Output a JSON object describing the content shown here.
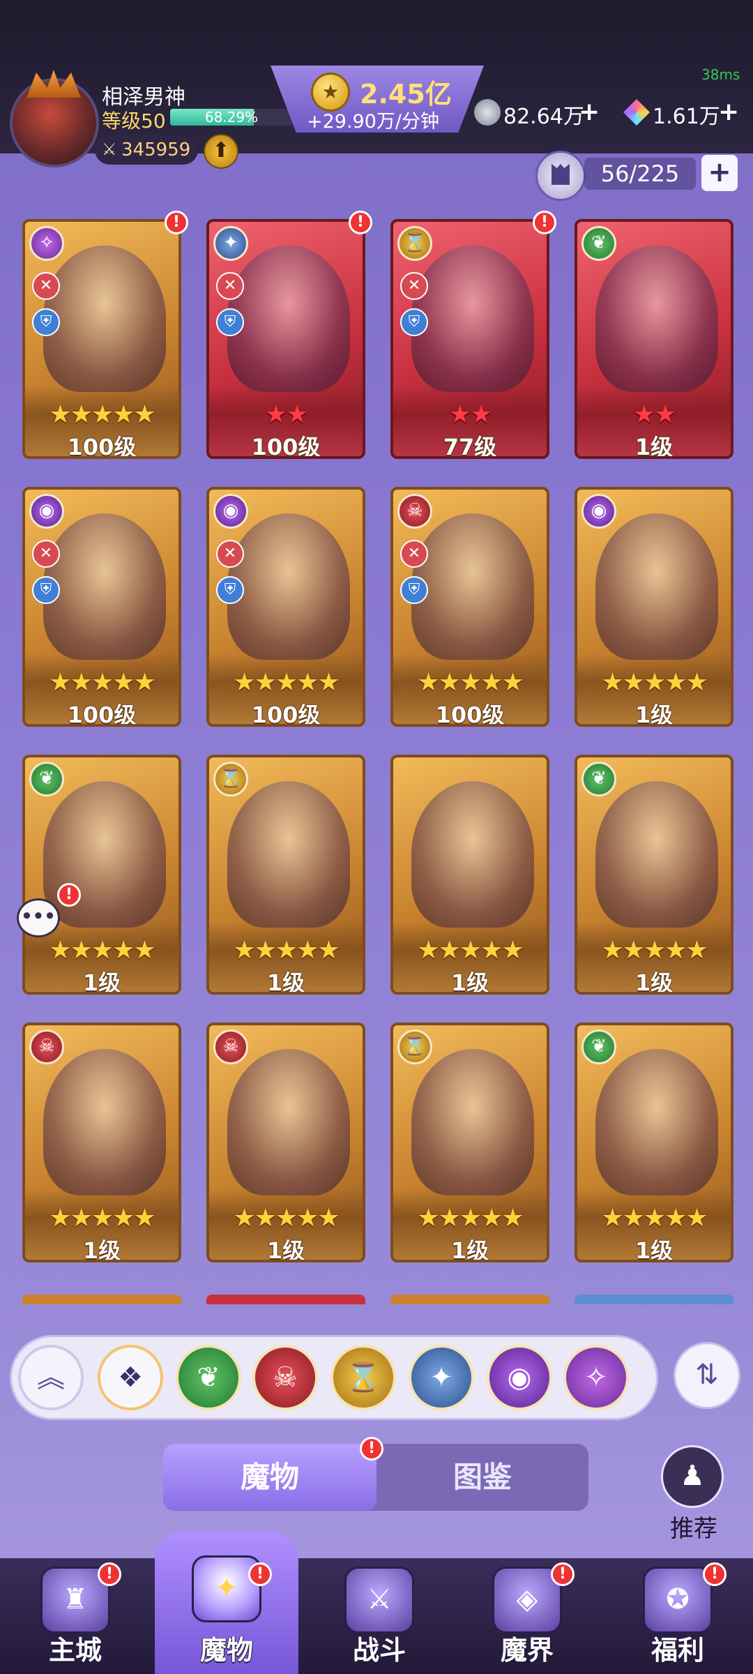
{
  "header": {
    "player_name": "相泽男神",
    "level_label": "等级50",
    "exp_text": "68.29%",
    "exp_fraction": 0.6829,
    "power_value": "345959",
    "gold_value": "2.45亿",
    "gold_rate": "+29.90万/分钟",
    "ping": "38ms",
    "silver_value": "82.64万",
    "gem_value": "1.61万",
    "capacity": "56/225"
  },
  "cards": [
    {
      "level": "100级",
      "stars": "★★★★★",
      "faction": "swirl",
      "theme": "gold"
    },
    {
      "level": "100级",
      "stars": "★★",
      "faction": "dragon",
      "theme": "red"
    },
    {
      "level": "77级",
      "stars": "★★",
      "faction": "time",
      "theme": "red"
    },
    {
      "level": "1级",
      "stars": "★★",
      "faction": "nature",
      "theme": "red"
    },
    {
      "level": "100级",
      "stars": "★★★★★",
      "faction": "eye",
      "theme": "gold"
    },
    {
      "level": "100级",
      "stars": "★★★★★",
      "faction": "eye",
      "theme": "gold"
    },
    {
      "level": "100级",
      "stars": "★★★★★",
      "faction": "demon",
      "theme": "gold"
    },
    {
      "level": "1级",
      "stars": "★★★★★",
      "faction": "eye",
      "theme": "gold"
    },
    {
      "level": "1级",
      "stars": "★★★★★",
      "faction": "nature",
      "theme": "gold"
    },
    {
      "level": "1级",
      "stars": "★★★★★",
      "faction": "time",
      "theme": "gold"
    },
    {
      "level": "1级",
      "stars": "★★★★★",
      "faction": "",
      "theme": "gold"
    },
    {
      "level": "1级",
      "stars": "★★★★★",
      "faction": "nature",
      "theme": "gold"
    },
    {
      "level": "1级",
      "stars": "★★★★★",
      "faction": "demon",
      "theme": "gold"
    },
    {
      "level": "1级",
      "stars": "★★★★★",
      "faction": "demon",
      "theme": "gold"
    },
    {
      "level": "1级",
      "stars": "★★★★★",
      "faction": "time",
      "theme": "gold"
    },
    {
      "level": "1级",
      "stars": "★★★★★",
      "faction": "nature",
      "theme": "gold"
    }
  ],
  "filters": [
    "collapse",
    "all",
    "nature",
    "demon",
    "time",
    "dragon",
    "eye",
    "swirl"
  ],
  "tabs": {
    "monsters": "魔物",
    "codex": "图鉴"
  },
  "recommend_label": "推荐",
  "nav": {
    "main_city": "主城",
    "monsters": "魔物",
    "battle": "战斗",
    "demon_realm": "魔界",
    "welfare": "福利"
  }
}
